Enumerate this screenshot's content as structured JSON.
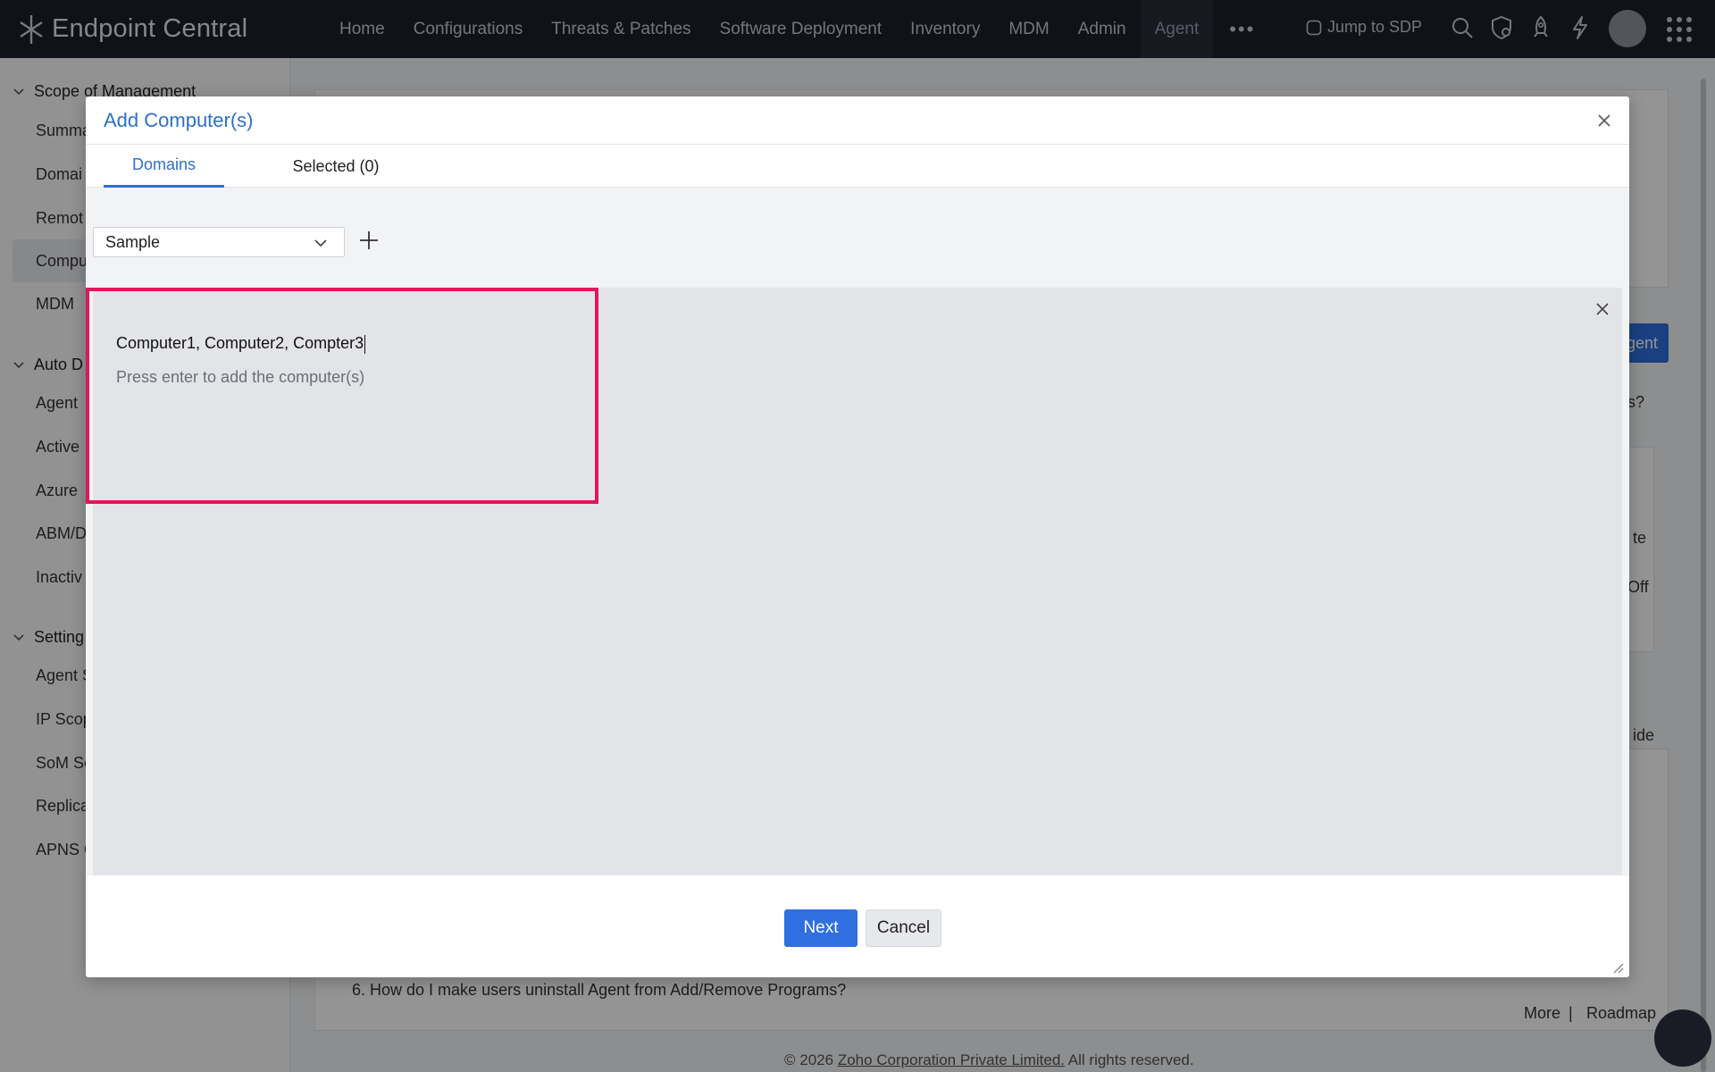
{
  "app": {
    "title": "Endpoint Central"
  },
  "nav": {
    "items": [
      "Home",
      "Configurations",
      "Threats & Patches",
      "Software Deployment",
      "Inventory",
      "MDM",
      "Admin",
      "Agent"
    ],
    "active": "Agent",
    "more": "•••",
    "jump_label": "Jump to SDP",
    "icons": [
      "search-icon",
      "shield-icon",
      "rocket-icon",
      "lightning-icon",
      "avatar",
      "apps-grid-icon"
    ]
  },
  "sidebar": {
    "sections": [
      {
        "label": "Scope of Management",
        "items": [
          "Summa",
          "Domai",
          "Remot",
          "Compu",
          "MDM"
        ]
      },
      {
        "label": "Auto D",
        "items": [
          "Agent",
          "Active",
          "Azure",
          "ABM/D",
          "Inactiv"
        ]
      },
      {
        "label": "Setting",
        "items": [
          "Agent S",
          "IP Scop",
          "SoM Se",
          "Replica",
          "APNS C"
        ]
      }
    ],
    "active_item": "Compu"
  },
  "background": {
    "install_agent_fragment": "gent",
    "help_fragment": "ls?",
    "remote_fragment": "te",
    "off_fragment": "Off",
    "guide_fragment": "ide",
    "faq_item": "6. How do I make users uninstall Agent from Add/Remove Programs?",
    "more_label": "More",
    "separator": "|",
    "roadmap_label": "Roadmap",
    "footer_prefix": "© 2026",
    "footer_company": "Zoho Corporation Private Limited.",
    "footer_suffix": "All rights reserved."
  },
  "modal": {
    "title": "Add Computer(s)",
    "tabs": [
      {
        "label": "Domains",
        "active": true
      },
      {
        "label": "Selected (0)",
        "active": false
      }
    ],
    "domain_select": {
      "value": "Sample"
    },
    "entry": {
      "value": "Computer1, Computer2, Compter3",
      "hint": "Press enter to add the computer(s)"
    },
    "buttons": {
      "next": "Next",
      "cancel": "Cancel"
    }
  },
  "colors": {
    "accent": "#2f6fdf",
    "highlight": "#e0175a",
    "topbar": "#1b1f2a"
  }
}
